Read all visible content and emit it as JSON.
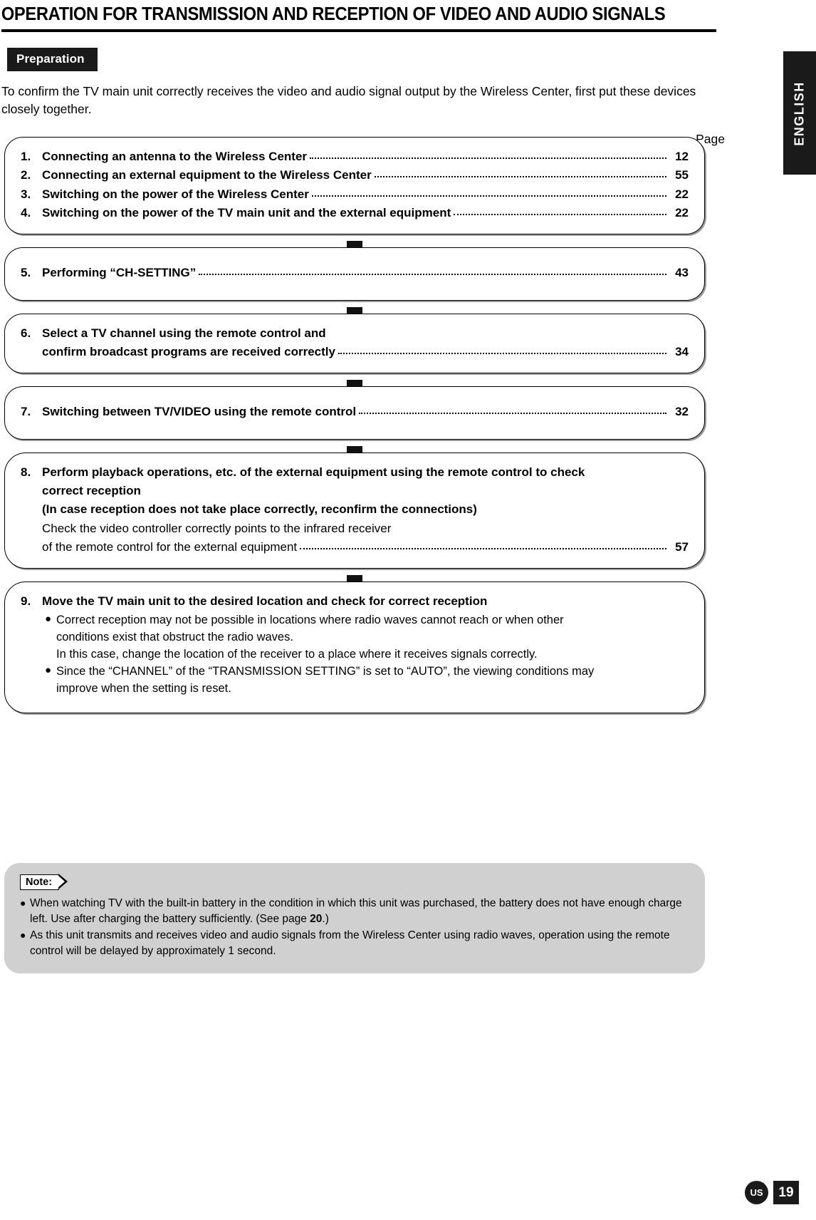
{
  "header": {
    "title": "OPERATION FOR TRANSMISSION  AND RECEPTION OF VIDEO AND AUDIO SIGNALS"
  },
  "section": {
    "tag": "Preparation",
    "intro": "To confirm the TV main unit correctly receives the video and audio signal output by the Wireless Center, first put these devices closely together.",
    "page_label": "Page"
  },
  "steps": [
    {
      "num": "1.",
      "label": "Connecting an antenna to the Wireless Center",
      "page": "12"
    },
    {
      "num": "2.",
      "label": "Connecting an external equipment to the Wireless Center",
      "page": "55"
    },
    {
      "num": "3.",
      "label": "Switching on the power of the Wireless Center",
      "page": "22"
    },
    {
      "num": "4.",
      "label": "Switching on the power of the TV main unit and the external equipment",
      "page": "22"
    },
    {
      "num": "5.",
      "label": "Performing “CH-SETTING”",
      "page": "43"
    },
    {
      "num": "6.",
      "line1": "Select a TV channel using the remote control and",
      "line2": "confirm broadcast programs are received correctly",
      "page": "34"
    },
    {
      "num": "7.",
      "label": "Switching between TV/VIDEO using the remote control",
      "page": "32"
    },
    {
      "num": "8.",
      "line1": "Perform playback operations, etc. of the external equipment using the remote control to check",
      "line2": "correct reception",
      "line3": "(In case reception does not take place correctly, reconfirm the connections)",
      "line4": "Check the video controller correctly points to the infrared receiver",
      "line5": "of the remote control for the external equipment",
      "page": "57"
    },
    {
      "num": "9.",
      "heading": "Move the TV main unit to the desired location and check for correct reception",
      "bullets": [
        "Correct reception may not be possible in locations where radio waves cannot reach or when other conditions exist that obstruct the radio waves.\nIn this case, change the location of the receiver to a place where it receives signals correctly.",
        "Since the “CHANNEL” of the “TRANSMISSION SETTING” is set to “AUTO”, the viewing conditions may improve when the setting is reset."
      ],
      "bullet1_line1": "Correct reception may not be possible in locations where radio waves cannot reach or when other",
      "bullet1_line2": "conditions exist that obstruct the radio waves.",
      "bullet1_line3": "In this case, change the location of the receiver to a place where it receives signals correctly.",
      "bullet2_line1": "Since the “CHANNEL” of the “TRANSMISSION SETTING” is set to “AUTO”, the viewing conditions may",
      "bullet2_line2": "improve when the setting is reset."
    }
  ],
  "note": {
    "tag": "Note:",
    "items": [
      {
        "pre": "When watching TV with the built-in battery in the condition in which this unit was purchased, the battery does not have enough charge left. Use after charging the battery sufficiently. (See page ",
        "bold": "20",
        "post": ".)"
      },
      {
        "pre": "As this unit transmits and receives video and audio signals from the Wireless Center using radio waves, operation using the remote control will be delayed by approximately 1 second.",
        "bold": "",
        "post": ""
      }
    ]
  },
  "sidebar": {
    "language": "ENGLISH"
  },
  "footer": {
    "region": "US",
    "page_number": "19"
  },
  "colors": {
    "ink": "#000000",
    "tag_bg": "#1a1a1a",
    "note_bg": "#d0d0d0",
    "box_shadow": "#9a9a9a"
  }
}
